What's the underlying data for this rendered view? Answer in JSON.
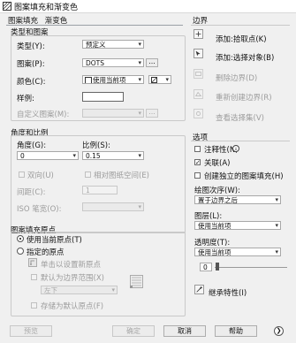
{
  "window": {
    "title": "图案填充和渐变色"
  },
  "tabs": {
    "hatch": "图案填充",
    "gradient": "渐变色"
  },
  "type_and_pattern": {
    "title": "类型和图案",
    "type_label": "类型(Y):",
    "type_value": "预定义",
    "pattern_label": "图案(P):",
    "pattern_value": "DOTS",
    "color_label": "颜色(C):",
    "color_value": "使用当前项",
    "bg_color_value": "",
    "swatch_label": "样例:",
    "custom_pattern_label": "自定义图案(M):",
    "ellipsis": "..."
  },
  "angle_scale": {
    "title": "角度和比例",
    "angle_label": "角度(G):",
    "angle_value": "0",
    "scale_label": "比例(S):",
    "scale_value": "0.15",
    "double_label": "双向(U)",
    "relative_label": "相对图纸空间(E)",
    "spacing_label": "间距(C):",
    "spacing_value": "1",
    "iso_label": "ISO 笔宽(O):"
  },
  "origin": {
    "title": "图案填充原点",
    "use_current": "使用当前原点(T)",
    "specified": "指定的原点",
    "click_set": "单击以设置新原点",
    "default_boundary": "默认为边界范围(X)",
    "position": "左下",
    "store_default": "存储为默认原点(F)"
  },
  "boundaries": {
    "title": "边界",
    "add_pick": "添加:拾取点(K)",
    "add_select": "添加:选择对象(B)",
    "remove": "删除边界(D)",
    "recreate": "重新创建边界(R)",
    "view": "查看选择集(V)"
  },
  "options": {
    "title": "选项",
    "annotative": "注释性(N)",
    "associative": "关联(A)",
    "separate": "创建独立的图案填充(H)",
    "draw_order_label": "绘图次序(W):",
    "draw_order_value": "置于边界之后",
    "layer_label": "图层(L):",
    "layer_value": "使用当前项",
    "transparency_label": "透明度(T):",
    "transparency_value": "使用当前项",
    "transparency_number": "0",
    "inherit": "继承特性(I)"
  },
  "footer": {
    "preview": "预览",
    "ok": "确定",
    "cancel": "取消",
    "help": "帮助",
    "more_glyph": "❯"
  }
}
